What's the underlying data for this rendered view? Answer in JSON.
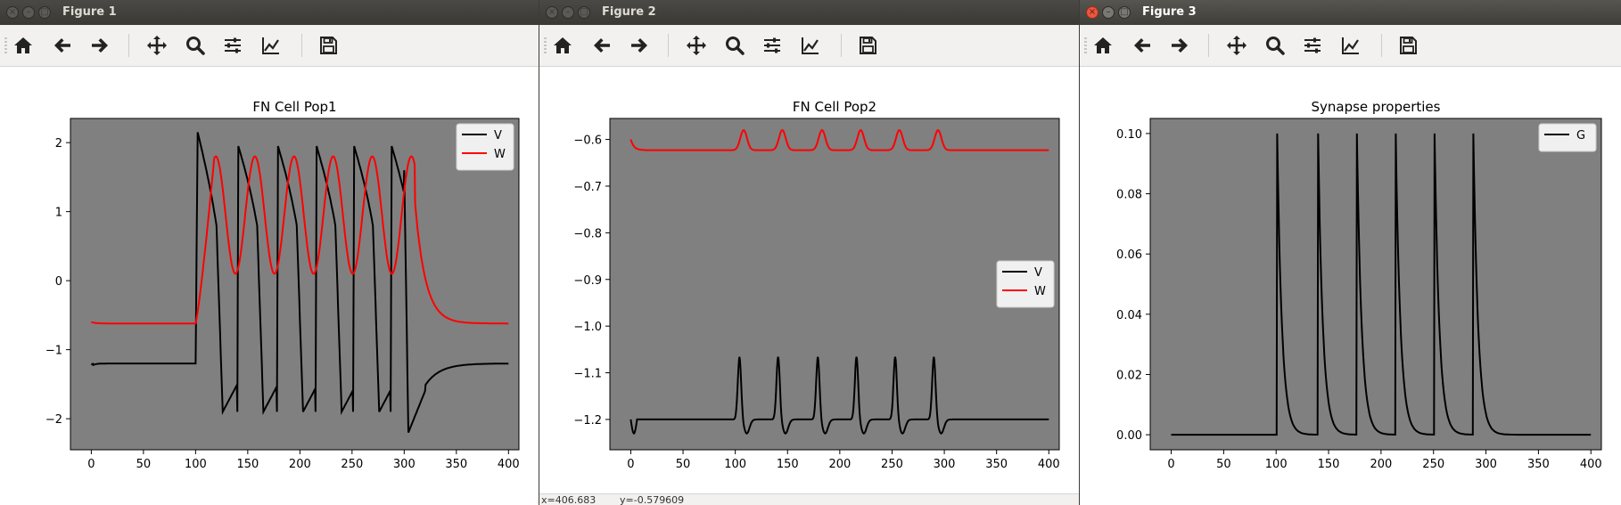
{
  "windows": [
    {
      "title": "Figure 1",
      "active": false,
      "status": {
        "x": "",
        "y": ""
      },
      "chart_data": {
        "type": "line",
        "title": "FN Cell Pop1",
        "xlabel": "",
        "ylabel": "",
        "xlim": [
          -20,
          410
        ],
        "ylim": [
          -2.45,
          2.35
        ],
        "xticks": [
          0,
          50,
          100,
          150,
          200,
          250,
          300,
          350,
          400
        ],
        "xtick_labels": [
          "0",
          "50",
          "100",
          "150",
          "200",
          "250",
          "300",
          "350",
          "400"
        ],
        "yticks": [
          -2,
          -1,
          0,
          1,
          2
        ],
        "ytick_labels": [
          "−2",
          "−1",
          "0",
          "1",
          "2"
        ],
        "background": "#808080",
        "legend": {
          "position": "top-right",
          "entries": [
            "V",
            "W"
          ]
        },
        "series": [
          {
            "name": "V",
            "color": "#000000",
            "kind": "fn_v",
            "values_desc": [
              [
                0,
                -1.2
              ],
              [
                100,
                -1.2
              ],
              [
                102,
                2.15
              ]
            ],
            "params": {
              "rest": -1.2,
              "min": -1.2,
              "start": 100,
              "end": 300,
              "peaks": [
                102,
                141,
                179,
                216,
                252,
                288
              ],
              "peak_val": [
                2.15,
                1.95,
                1.95,
                1.95,
                1.95,
                1.95
              ],
              "trough_val": -1.9
            }
          },
          {
            "name": "W",
            "color": "#ff0000",
            "kind": "fn_w",
            "params": {
              "rest": -0.62,
              "start": 100,
              "end": 300,
              "peaks": [
                122,
                160,
                198,
                234,
                270,
                303
              ],
              "peak_val": 1.8,
              "trough_val": 0.15
            }
          }
        ]
      }
    },
    {
      "title": "Figure 2",
      "active": false,
      "status": {
        "x": "x=406.683",
        "y": "y=-0.579609"
      },
      "chart_data": {
        "type": "line",
        "title": "FN Cell Pop2",
        "xlabel": "",
        "ylabel": "",
        "xlim": [
          -20,
          410
        ],
        "ylim": [
          -1.265,
          -0.555
        ],
        "xticks": [
          0,
          50,
          100,
          150,
          200,
          250,
          300,
          350,
          400
        ],
        "xtick_labels": [
          "0",
          "50",
          "100",
          "150",
          "200",
          "250",
          "300",
          "350",
          "400"
        ],
        "yticks": [
          -1.2,
          -1.1,
          -1.0,
          -0.9,
          -0.8,
          -0.7,
          -0.6
        ],
        "ytick_labels": [
          "−1.2",
          "−1.1",
          "−1.0",
          "−0.9",
          "−0.8",
          "−0.7",
          "−0.6"
        ],
        "background": "#808080",
        "legend": {
          "position": "center-right",
          "entries": [
            "V",
            "W"
          ]
        },
        "series": [
          {
            "name": "V",
            "color": "#000000",
            "kind": "small_v",
            "params": {
              "rest": -1.2,
              "peaks": [
                104,
                141,
                179,
                216,
                253,
                290
              ],
              "peak_val": -1.065,
              "dip_val": -1.23
            }
          },
          {
            "name": "W",
            "color": "#ff0000",
            "kind": "small_w",
            "params": {
              "rest": -0.623,
              "start": -0.6,
              "peaks": [
                108,
                145,
                183,
                220,
                257,
                294
              ],
              "peak_val": -0.58
            }
          }
        ]
      }
    },
    {
      "title": "Figure 3",
      "active": true,
      "status": {
        "x": "",
        "y": ""
      },
      "chart_data": {
        "type": "line",
        "title": "Synapse properties",
        "xlabel": "",
        "ylabel": "",
        "xlim": [
          -20,
          410
        ],
        "ylim": [
          -0.005,
          0.105
        ],
        "xticks": [
          0,
          50,
          100,
          150,
          200,
          250,
          300,
          350,
          400
        ],
        "xtick_labels": [
          "0",
          "50",
          "100",
          "150",
          "200",
          "250",
          "300",
          "350",
          "400"
        ],
        "yticks": [
          0.0,
          0.02,
          0.04,
          0.06,
          0.08,
          0.1
        ],
        "ytick_labels": [
          "0.00",
          "0.02",
          "0.04",
          "0.06",
          "0.08",
          "0.10"
        ],
        "background": "#808080",
        "legend": {
          "position": "top-right",
          "entries": [
            "G"
          ]
        },
        "series": [
          {
            "name": "G",
            "color": "#000000",
            "kind": "synapse",
            "params": {
              "peaks": [
                101,
                140,
                177,
                214,
                251,
                288
              ],
              "peak_val": 0.1,
              "tau": 4.5
            }
          }
        ]
      }
    }
  ],
  "toolbar": {
    "buttons": [
      "home-icon",
      "back-arrow-icon",
      "forward-arrow-icon",
      "pan-icon",
      "zoom-icon",
      "subplots-icon",
      "axes-edit-icon",
      "save-icon"
    ]
  }
}
